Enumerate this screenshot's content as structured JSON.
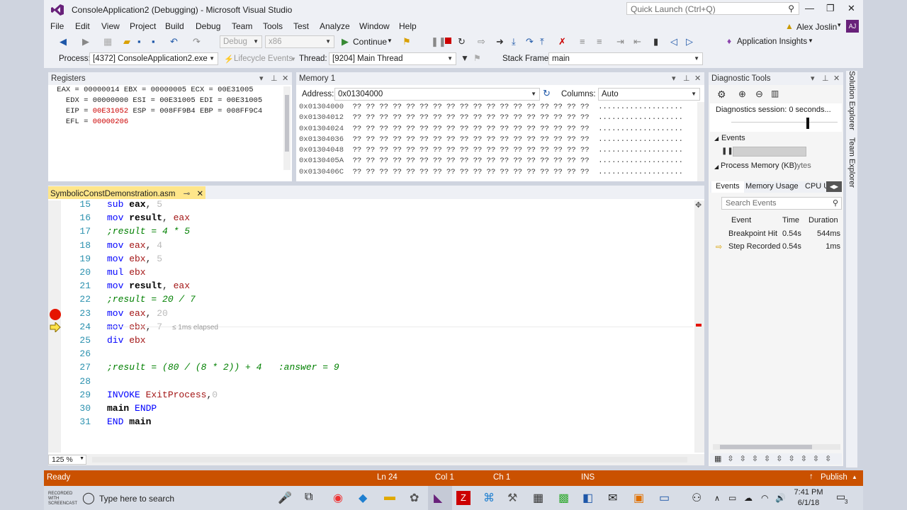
{
  "window": {
    "title": "ConsoleApplication2 (Debugging) - Microsoft Visual Studio",
    "notifications": "1",
    "quick_launch_placeholder": "Quick Launch (Ctrl+Q)"
  },
  "menu": [
    "File",
    "Edit",
    "View",
    "Project",
    "Build",
    "Debug",
    "Team",
    "Tools",
    "Test",
    "Analyze",
    "Window",
    "Help"
  ],
  "user": {
    "name": "Alex Joslin",
    "initials": "AJ"
  },
  "toolbar": {
    "config": "Debug",
    "platform": "x86",
    "continue_label": "Continue",
    "app_insights": "Application Insights"
  },
  "debugbar": {
    "process_label": "Process:",
    "process_value": "[4372] ConsoleApplication2.exe",
    "lifecycle_label": "Lifecycle Events",
    "thread_label": "Thread:",
    "thread_value": "[9204] Main Thread",
    "stackframe_label": "Stack Frame:",
    "stackframe_value": "main"
  },
  "registers": {
    "title": "Registers",
    "lines": [
      {
        "a": " EAX = 00000014 ",
        "b": "",
        "c": "EBX = 00000005 ECX = 00E31005"
      },
      {
        "a": "   EDX = 00000000 ESI = 00E31005 EDI = 00E31005",
        "b": "",
        "c": ""
      },
      {
        "a": "   EIP = ",
        "b": "00E31052",
        "c": " ESP = 008FF9B4 EBP = 008FF9C4"
      },
      {
        "a": "   EFL = ",
        "b": "00000206",
        "c": ""
      }
    ]
  },
  "memory": {
    "title": "Memory 1",
    "address_label": "Address:",
    "address_value": "0x01304000",
    "columns_label": "Columns:",
    "columns_value": "Auto",
    "rows": [
      {
        "addr": "0x01304000",
        "bytes": "?? ?? ?? ?? ?? ?? ?? ?? ?? ?? ?? ?? ?? ?? ?? ?? ?? ??",
        "chars": "..................."
      },
      {
        "addr": "0x01304012",
        "bytes": "?? ?? ?? ?? ?? ?? ?? ?? ?? ?? ?? ?? ?? ?? ?? ?? ?? ??",
        "chars": "..................."
      },
      {
        "addr": "0x01304024",
        "bytes": "?? ?? ?? ?? ?? ?? ?? ?? ?? ?? ?? ?? ?? ?? ?? ?? ?? ??",
        "chars": "..................."
      },
      {
        "addr": "0x01304036",
        "bytes": "?? ?? ?? ?? ?? ?? ?? ?? ?? ?? ?? ?? ?? ?? ?? ?? ?? ??",
        "chars": "..................."
      },
      {
        "addr": "0x01304048",
        "bytes": "?? ?? ?? ?? ?? ?? ?? ?? ?? ?? ?? ?? ?? ?? ?? ?? ?? ??",
        "chars": "..................."
      },
      {
        "addr": "0x0130405A",
        "bytes": "?? ?? ?? ?? ?? ?? ?? ?? ?? ?? ?? ?? ?? ?? ?? ?? ?? ??",
        "chars": "..................."
      },
      {
        "addr": "0x0130406C",
        "bytes": "?? ?? ?? ?? ?? ?? ?? ?? ?? ?? ?? ?? ?? ?? ?? ?? ?? ??",
        "chars": "..................."
      }
    ]
  },
  "diag": {
    "title": "Diagnostic Tools",
    "session": "Diagnostics session: 0 seconds...",
    "events_section": "Events",
    "process_memory": "Process Memory (KB)",
    "process_memory_tail": "ytes",
    "tabs": [
      "Events",
      "Memory Usage",
      "CPU U"
    ],
    "search_placeholder": "Search Events",
    "cols": [
      "Event",
      "Time",
      "Duration"
    ],
    "events": [
      {
        "name": "Breakpoint Hit",
        "time": "0.54s",
        "dur": "544ms"
      },
      {
        "name": "Step Recorded",
        "time": "0.54s",
        "dur": "1ms"
      }
    ]
  },
  "side_tabs": [
    "Solution Explorer",
    "Team Explorer"
  ],
  "editor": {
    "tab": "SymbolicConstDemonstration.asm",
    "zoom": "125 %",
    "elapsed": "≤ 1ms elapsed",
    "lines": [
      {
        "n": "15",
        "t": [
          [
            "kw",
            "sub"
          ],
          [
            "op",
            " eax"
          ],
          [
            "",
            ", "
          ],
          [
            "num",
            "5"
          ]
        ]
      },
      {
        "n": "16",
        "t": [
          [
            "kw",
            "mov"
          ],
          [
            "op",
            " result"
          ],
          [
            "",
            ", "
          ],
          [
            "fn",
            "eax"
          ]
        ]
      },
      {
        "n": "17",
        "t": [
          [
            "com",
            ";result = 4 * 5"
          ]
        ]
      },
      {
        "n": "18",
        "t": [
          [
            "kw",
            "mov"
          ],
          [
            "fn",
            " eax"
          ],
          [
            "",
            ", "
          ],
          [
            "num",
            "4"
          ]
        ]
      },
      {
        "n": "19",
        "t": [
          [
            "kw",
            "mov"
          ],
          [
            "fn",
            " ebx"
          ],
          [
            "",
            ", "
          ],
          [
            "num",
            "5"
          ]
        ]
      },
      {
        "n": "20",
        "t": [
          [
            "kw",
            "mul"
          ],
          [
            "fn",
            " ebx"
          ]
        ]
      },
      {
        "n": "21",
        "t": [
          [
            "kw",
            "mov"
          ],
          [
            "op",
            " result"
          ],
          [
            "",
            ", "
          ],
          [
            "fn",
            "eax"
          ]
        ]
      },
      {
        "n": "22",
        "t": [
          [
            "com",
            ";result = 20 / 7"
          ]
        ]
      },
      {
        "n": "23",
        "t": [
          [
            "kw",
            "mov"
          ],
          [
            "fn",
            " eax"
          ],
          [
            "",
            ", "
          ],
          [
            "num",
            "20"
          ]
        ]
      },
      {
        "n": "24",
        "t": [
          [
            "kw",
            "mov"
          ],
          [
            "fn",
            " ebx"
          ],
          [
            "",
            ", "
          ],
          [
            "num",
            "7"
          ]
        ]
      },
      {
        "n": "25",
        "t": [
          [
            "kw",
            "div"
          ],
          [
            "fn",
            " ebx"
          ]
        ]
      },
      {
        "n": "26",
        "t": []
      },
      {
        "n": "27",
        "t": [
          [
            "com",
            ";result = (80 / (8 * 2)) + 4   :answer = 9"
          ]
        ]
      },
      {
        "n": "28",
        "t": []
      },
      {
        "n": "29",
        "t": [
          [
            "kw",
            "INVOKE"
          ],
          [
            "fn",
            " ExitProcess"
          ],
          [
            "",
            ","
          ],
          [
            "num",
            "0"
          ]
        ]
      },
      {
        "n": "30",
        "t": [
          [
            "op",
            "main"
          ],
          [
            "kw",
            " ENDP"
          ]
        ]
      },
      {
        "n": "31",
        "t": [
          [
            "kw",
            "END"
          ],
          [
            "op",
            " main"
          ]
        ]
      }
    ]
  },
  "status": {
    "ready": "Ready",
    "ln": "Ln 24",
    "col": "Col 1",
    "ch": "Ch 1",
    "ins": "INS",
    "publish": "Publish"
  },
  "taskbar": {
    "search_placeholder": "Type here to search",
    "time": "7:41 PM",
    "date": "6/1/18",
    "watermark": "RECORDED WITH SCREENCAST",
    "notif_count": "3"
  },
  "colors": {
    "statusbar": "#ca5100",
    "breakpoint": "#e51400",
    "accent": "#68217a"
  }
}
